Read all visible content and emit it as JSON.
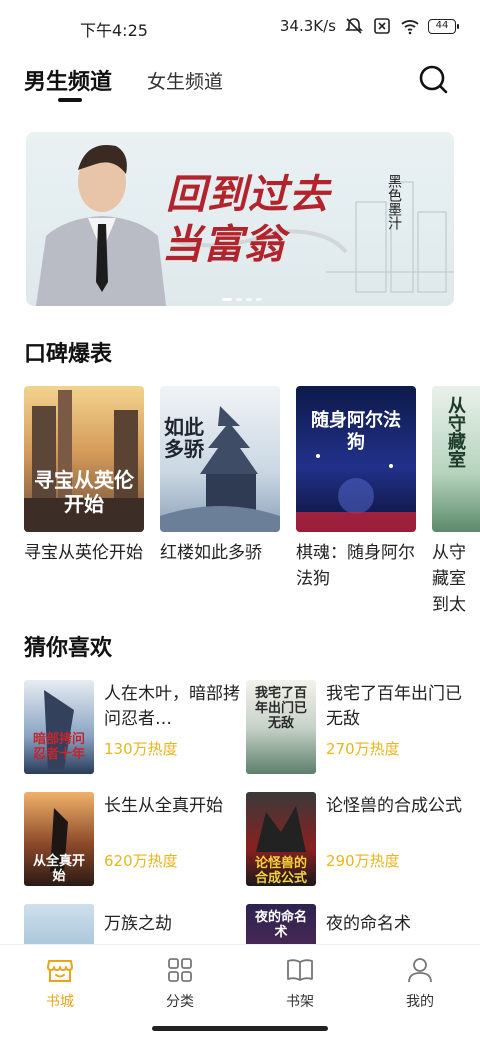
{
  "status_bar": {
    "time": "下午4:25",
    "speed": "34.3K/s",
    "battery": "44",
    "icons": [
      "mute-icon",
      "sim-off-icon",
      "wifi-icon",
      "battery-icon"
    ]
  },
  "top_tabs": {
    "male": "男生频道",
    "female": "女生频道",
    "search_icon": "search-icon"
  },
  "banner": {
    "title_line1": "回到过去",
    "title_line2": "当富翁",
    "author": "黑色墨汁",
    "accent_color": "#b3232b"
  },
  "popular": {
    "title": "口碑爆表",
    "items": [
      {
        "name": "寻宝从英伦开始",
        "cover_text": "寻宝从英伦开始"
      },
      {
        "name": "红楼如此多骄",
        "cover_text": "如此多骄"
      },
      {
        "name": "棋魂：随身阿尔法狗",
        "cover_text": "随身阿尔法狗"
      },
      {
        "name": "从守藏室到太",
        "cover_text": "从守藏室"
      }
    ]
  },
  "guess": {
    "title": "猜你喜欢",
    "items": [
      {
        "title": "人在木叶，暗部拷问忍者…",
        "heat": "130万热度",
        "cover_text": "暗部拷问忍者十年"
      },
      {
        "title": "我宅了百年出门已无敌",
        "heat": "270万热度",
        "cover_text": "我宅了百年出门已无敌"
      },
      {
        "title": "长生从全真开始",
        "heat": "620万热度",
        "cover_text": "从全真开始"
      },
      {
        "title": "论怪兽的合成公式",
        "heat": "290万热度",
        "cover_text": "论怪兽的合成公式"
      },
      {
        "title": "万族之劫",
        "heat": "",
        "cover_text": ""
      },
      {
        "title": "夜的命名术",
        "heat": "",
        "cover_text": "夜的命名术"
      }
    ],
    "heat_color": "#e8b61c"
  },
  "bottom_nav": {
    "items": [
      {
        "label": "书城",
        "icon": "bookstore-icon",
        "active": true
      },
      {
        "label": "分类",
        "icon": "category-grid-icon",
        "active": false
      },
      {
        "label": "书架",
        "icon": "bookshelf-icon",
        "active": false
      },
      {
        "label": "我的",
        "icon": "profile-icon",
        "active": false
      }
    ],
    "active_color": "#e8a51c"
  }
}
